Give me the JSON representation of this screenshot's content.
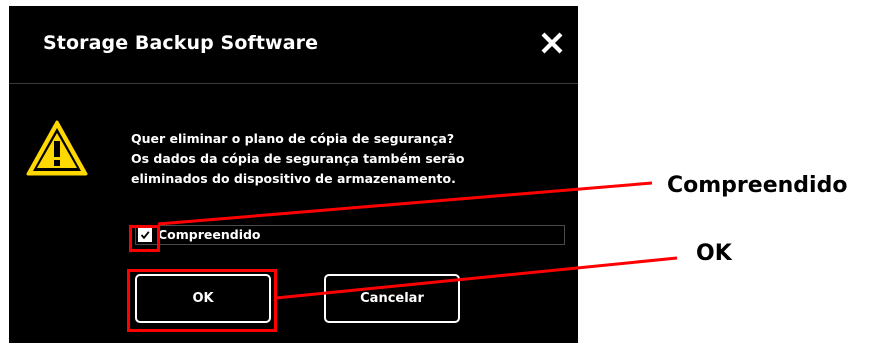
{
  "dialog": {
    "title": "Storage Backup Software",
    "close_icon": "close-icon",
    "warning_icon": "warning-triangle-icon",
    "message_lines": [
      "Quer eliminar o plano de cópia de segurança?",
      "Os dados da cópia de segurança também serão",
      "eliminados do dispositivo de armazenamento."
    ],
    "checkbox_label": "Compreendido",
    "checkbox_checked": true,
    "ok_label": "OK",
    "cancel_label": "Cancelar"
  },
  "annotations": {
    "checkbox_callout": "Compreendido",
    "ok_callout": "OK",
    "highlight_color": "#ff0000"
  },
  "colors": {
    "dialog_background": "#000000",
    "text": "#ffffff",
    "warning_yellow": "#ffd800"
  }
}
